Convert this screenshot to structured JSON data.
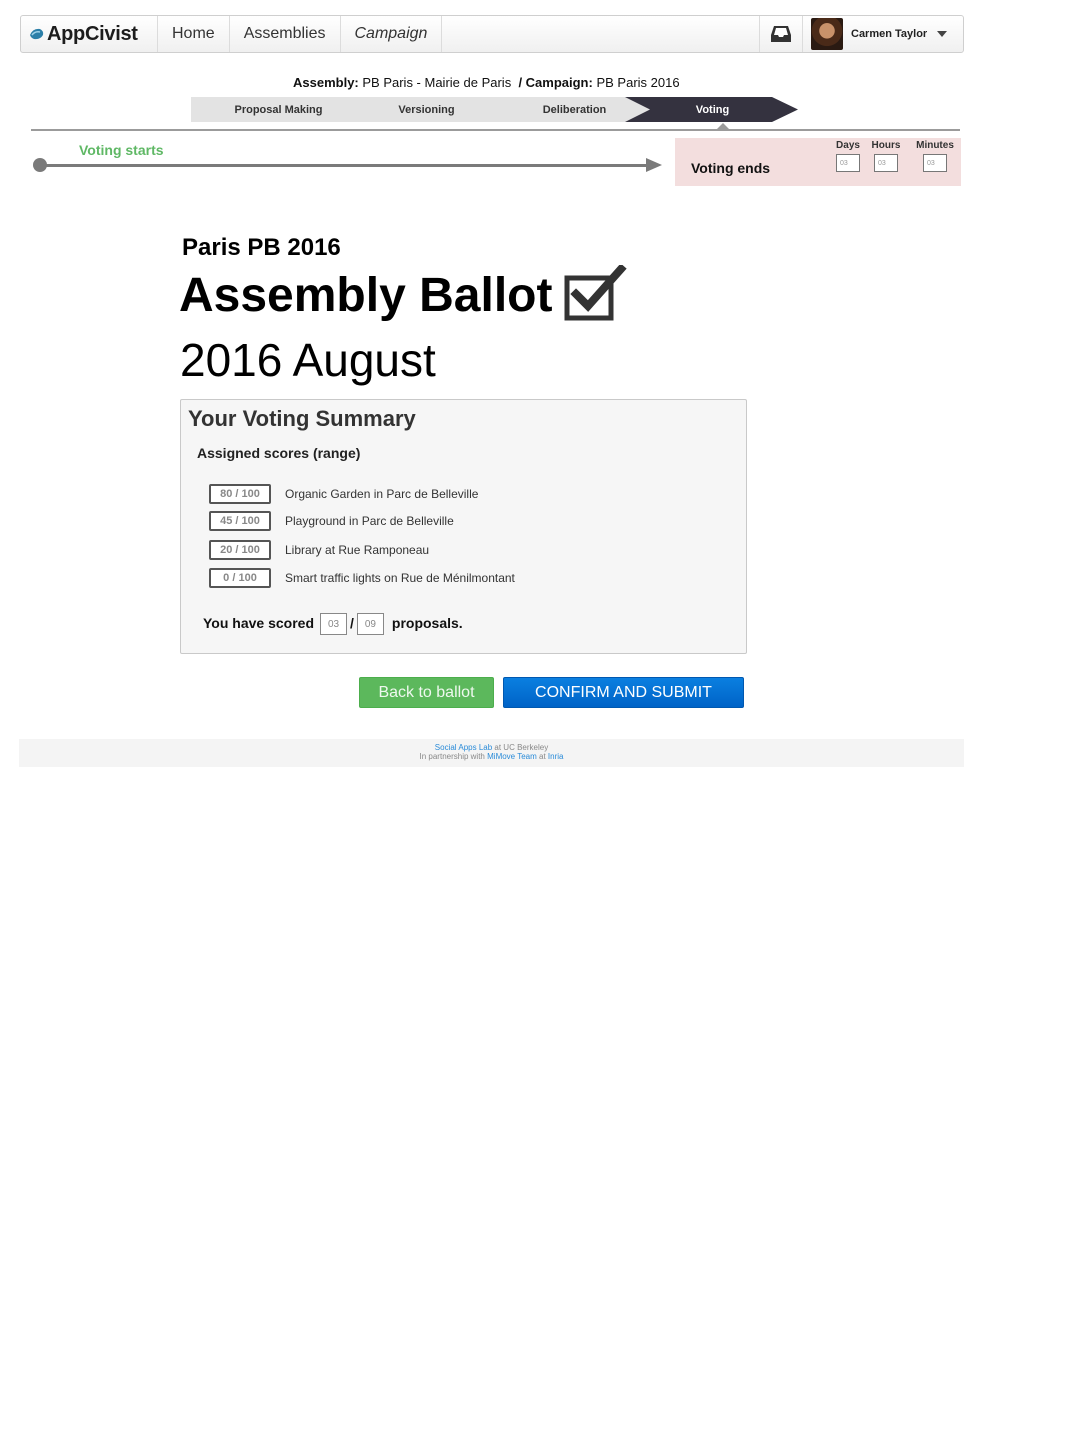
{
  "navbar": {
    "brand": "AppCivist",
    "items": [
      {
        "label": "Home"
      },
      {
        "label": "Assemblies"
      },
      {
        "label": "Campaign"
      }
    ],
    "user_name": "Carmen Taylor"
  },
  "breadcrumb": {
    "assembly_label": "Assembly:",
    "assembly_value": "PB Paris - Mairie de Paris",
    "campaign_label": "/ Campaign:",
    "campaign_value": "PB Paris 2016"
  },
  "phases": [
    {
      "label": "Proposal Making",
      "active": false
    },
    {
      "label": "Versioning",
      "active": false
    },
    {
      "label": "Deliberation",
      "active": false
    },
    {
      "label": "Voting",
      "active": true
    }
  ],
  "timeline": {
    "start_label": "Voting starts",
    "end_label": "Voting ends",
    "countdown": [
      {
        "unit": "Days",
        "value": "03"
      },
      {
        "unit": "Hours",
        "value": "03"
      },
      {
        "unit": "Minutes",
        "value": "03"
      }
    ]
  },
  "heading": {
    "subtitle": "Paris PB 2016",
    "title": "Assembly Ballot",
    "date": "2016 August"
  },
  "summary": {
    "title": "Your Voting Summary",
    "subtitle": "Assigned scores (range)",
    "scores": [
      {
        "score": "80 / 100",
        "proposal": "Organic Garden in Parc de Belleville"
      },
      {
        "score": "45 / 100",
        "proposal": "Playground in Parc de Belleville"
      },
      {
        "score": "20 / 100",
        "proposal": "Library at Rue Ramponeau"
      },
      {
        "score": "0 / 100",
        "proposal": "Smart traffic lights on Rue de Ménilmontant"
      }
    ],
    "scored_prefix": "You have scored",
    "scored_count": "03",
    "slash": "/",
    "total_count": "09",
    "scored_suffix": "proposals."
  },
  "buttons": {
    "back": "Back to ballot",
    "confirm": "CONFIRM AND SUBMIT"
  },
  "footer": {
    "lab": "Social Apps Lab",
    "at_ucb": "at UC Berkeley",
    "partnership": "In partnership with",
    "team": "MiMove Team",
    "at": "at",
    "inria": "Inria"
  },
  "colors": {
    "accent_blue": "#0070d8",
    "success_green": "#5cb85c",
    "phase_active": "#34323f",
    "phase_inactive": "#e3e3e3",
    "voting_ends_bg": "#f3dede"
  },
  "icons": [
    "appcivist-logo-icon",
    "inbox-icon",
    "caret-down-icon",
    "checkbox-checked-icon"
  ]
}
